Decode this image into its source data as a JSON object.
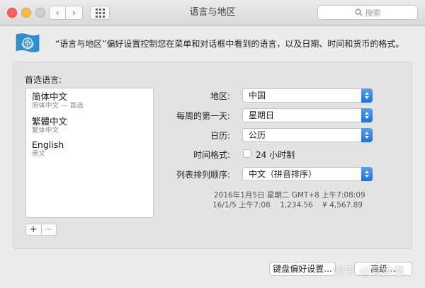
{
  "window": {
    "title": "语言与地区"
  },
  "search": {
    "placeholder": "搜索"
  },
  "header": {
    "description": "“语言与地区”偏好设置控制您在菜单和对话框中看到的语言，以及日期、时间和货币的格式。"
  },
  "preferred_languages": {
    "label": "首选语言:",
    "items": [
      {
        "name": "简体中文",
        "sub": "简体中文 — 首选"
      },
      {
        "name": "繁體中文",
        "sub": "繁体中文"
      },
      {
        "name": "English",
        "sub": "英文"
      }
    ],
    "add_label": "+",
    "remove_label": "−"
  },
  "settings": {
    "region": {
      "label": "地区:",
      "value": "中国"
    },
    "first_day": {
      "label": "每周的第一天:",
      "value": "星期日"
    },
    "calendar": {
      "label": "日历:",
      "value": "公历"
    },
    "time_format": {
      "label": "时间格式:",
      "checkbox_label": "24 小时制",
      "checked": false
    },
    "list_sort": {
      "label": "列表排列顺序:",
      "value": "中文（拼音排序）"
    }
  },
  "samples": {
    "line1": "2016年1月5日 星期二 GMT+8 上午7:08:09",
    "line2": "16/1/5 上午7:08    1,234.56    ¥ 4,567.89"
  },
  "buttons": {
    "keyboard_prefs": "键盘偏好设置...",
    "advanced": "高级..."
  },
  "watermark": "知乎 @葛仲音",
  "colors": {
    "accent": "#1f6fe0",
    "close": "#fc615d",
    "minimize": "#fdbc40",
    "flag": "#2d8fd6"
  }
}
